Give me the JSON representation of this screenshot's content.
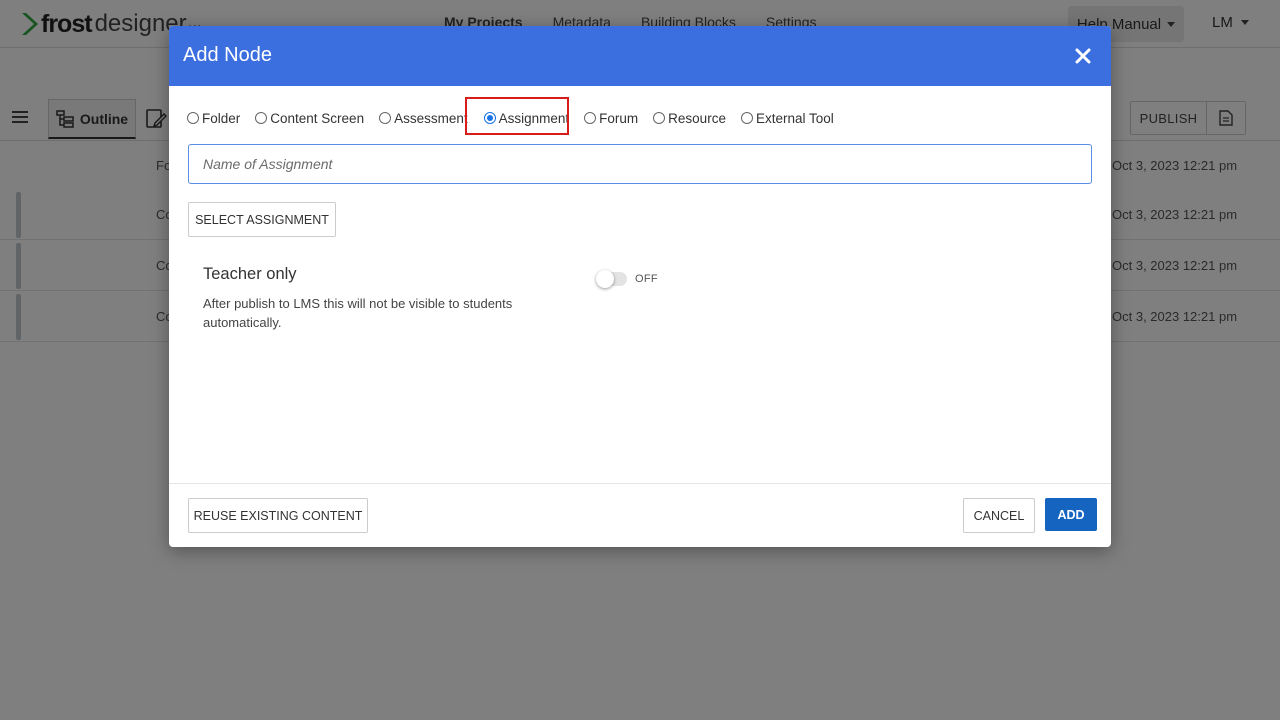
{
  "app": {
    "logo_bold": "frost",
    "logo_light": "designer",
    "more": "...",
    "nav": [
      "My Projects",
      "Metadata",
      "Building Blocks",
      "Settings"
    ],
    "help_label": "Help Manual",
    "user_initials": "LM",
    "brand_color": "#2eaa44"
  },
  "toolbar": {
    "outline_label": "Outline",
    "publish_label": "PUBLISH"
  },
  "rows": [
    {
      "label": "Fo",
      "date": "Oct 3, 2023 12:21 pm"
    },
    {
      "label": "Co",
      "date": "Oct 3, 2023 12:21 pm"
    },
    {
      "label": "Co",
      "date": "Oct 3, 2023 12:21 pm"
    },
    {
      "label": "Co",
      "date": "Oct 3, 2023 12:21 pm"
    }
  ],
  "modal": {
    "title": "Add Node",
    "header_color": "#3b6fe0",
    "node_types": [
      "Folder",
      "Content Screen",
      "Assessment",
      "Assignment",
      "Forum",
      "Resource",
      "External Tool"
    ],
    "selected_type": "Assignment",
    "name_placeholder": "Name of Assignment",
    "name_value": "",
    "select_button": "SELECT ASSIGNMENT",
    "teacher_only_title": "Teacher only",
    "teacher_only_desc": "After publish to LMS this will not be visible to students automatically.",
    "toggle_state": "OFF",
    "reuse_button": "REUSE EXISTING CONTENT",
    "cancel_button": "CANCEL",
    "add_button": "ADD",
    "highlight_color": "#d81b1b"
  }
}
